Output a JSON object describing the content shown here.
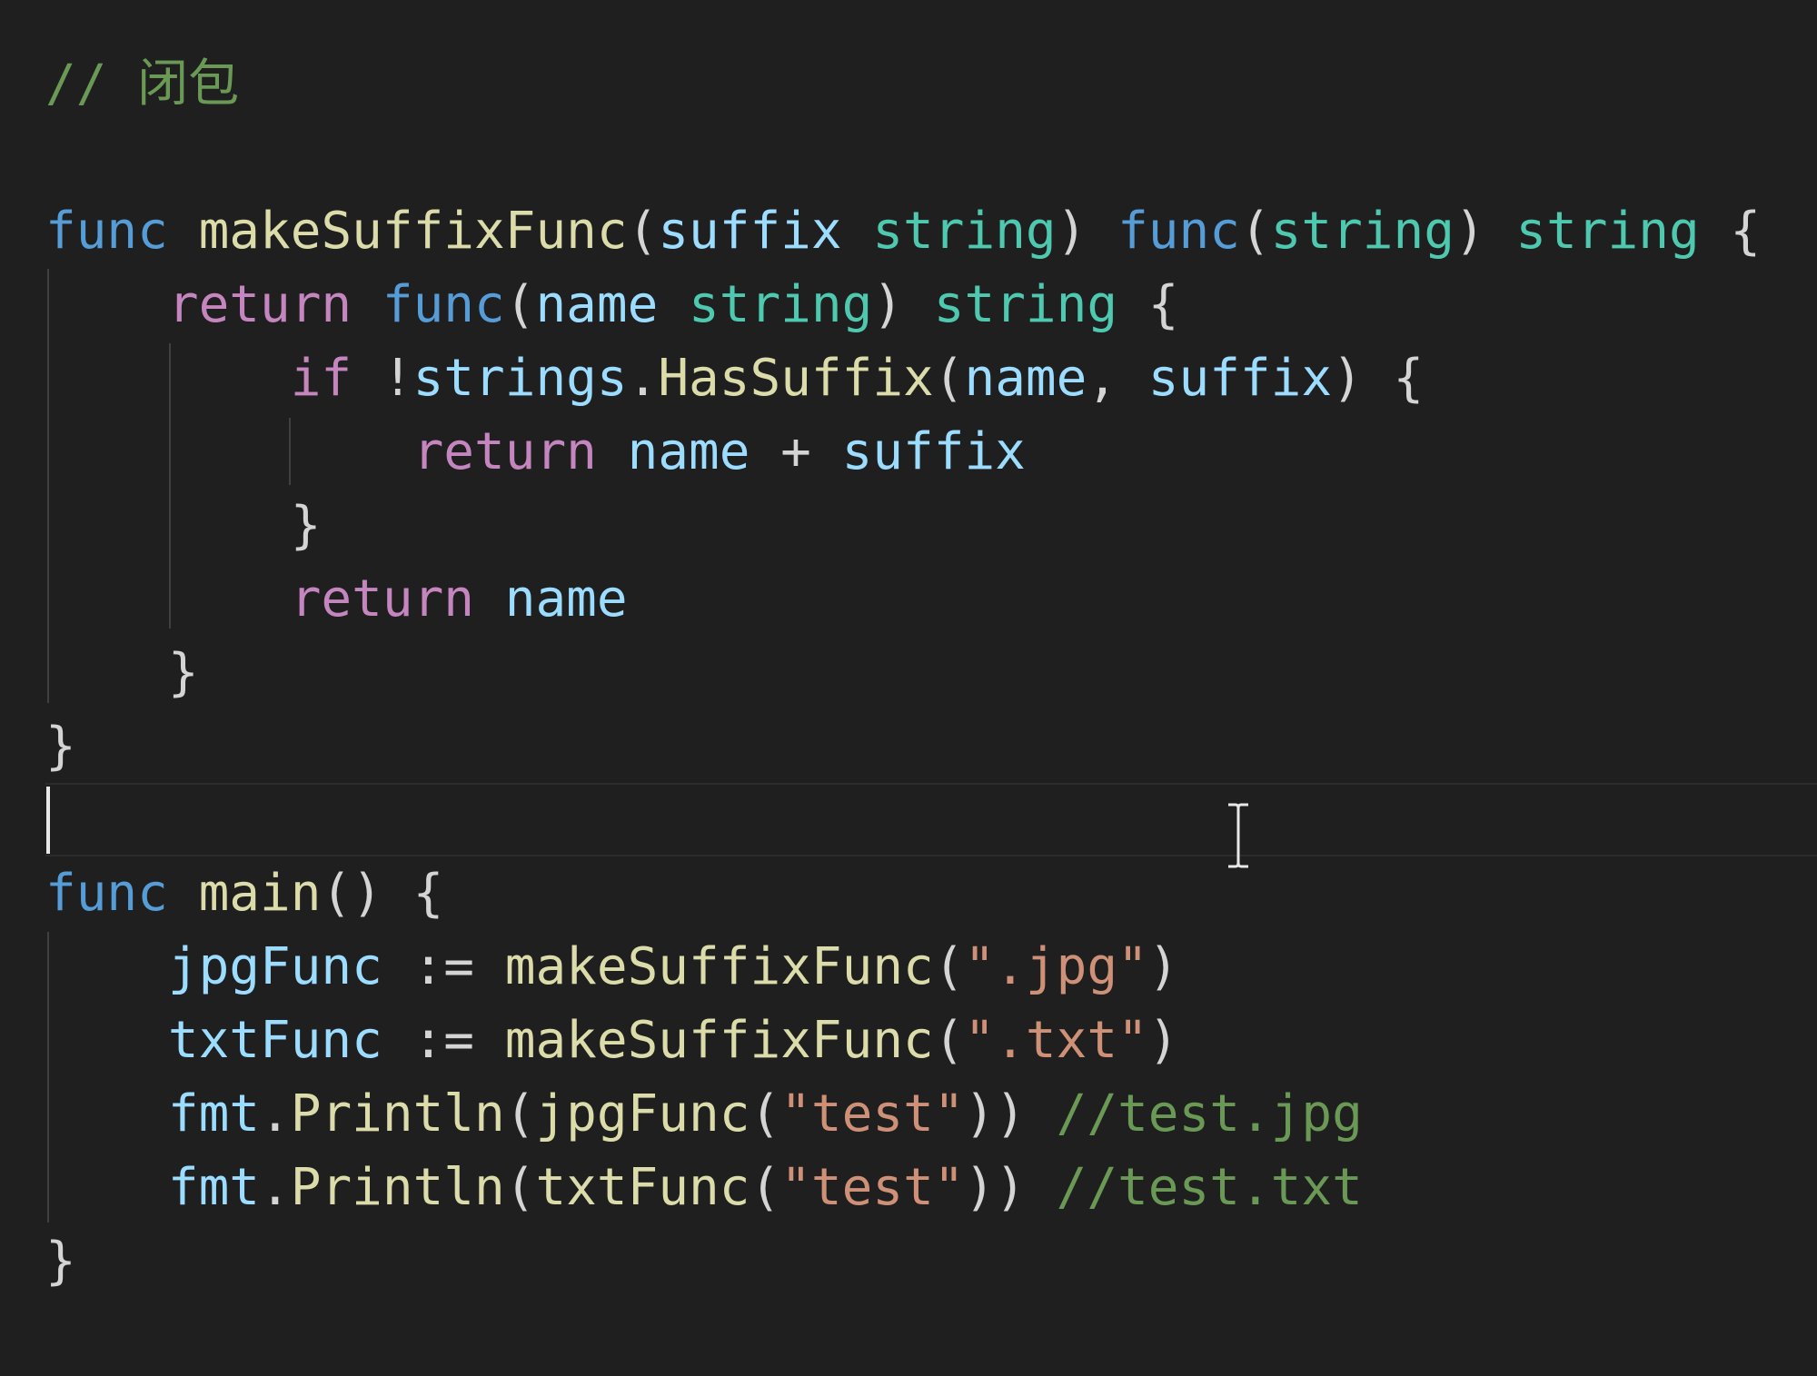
{
  "editor": {
    "lines": [
      [
        {
          "t": "// 闭包",
          "c": "comment"
        }
      ],
      [],
      [
        {
          "t": "func",
          "c": "keyword"
        },
        {
          "t": " ",
          "c": "punct"
        },
        {
          "t": "makeSuffixFunc",
          "c": "func"
        },
        {
          "t": "(",
          "c": "punct"
        },
        {
          "t": "suffix",
          "c": "param"
        },
        {
          "t": " ",
          "c": "punct"
        },
        {
          "t": "string",
          "c": "type"
        },
        {
          "t": ") ",
          "c": "punct"
        },
        {
          "t": "func",
          "c": "keyword"
        },
        {
          "t": "(",
          "c": "punct"
        },
        {
          "t": "string",
          "c": "type"
        },
        {
          "t": ") ",
          "c": "punct"
        },
        {
          "t": "string",
          "c": "type"
        },
        {
          "t": " {",
          "c": "punct"
        }
      ],
      [
        {
          "t": "    ",
          "c": "punct"
        },
        {
          "t": "return",
          "c": "control"
        },
        {
          "t": " ",
          "c": "punct"
        },
        {
          "t": "func",
          "c": "keyword"
        },
        {
          "t": "(",
          "c": "punct"
        },
        {
          "t": "name",
          "c": "param"
        },
        {
          "t": " ",
          "c": "punct"
        },
        {
          "t": "string",
          "c": "type"
        },
        {
          "t": ") ",
          "c": "punct"
        },
        {
          "t": "string",
          "c": "type"
        },
        {
          "t": " {",
          "c": "punct"
        }
      ],
      [
        {
          "t": "        ",
          "c": "punct"
        },
        {
          "t": "if",
          "c": "control"
        },
        {
          "t": " !",
          "c": "op"
        },
        {
          "t": "strings",
          "c": "param"
        },
        {
          "t": ".",
          "c": "punct"
        },
        {
          "t": "HasSuffix",
          "c": "func"
        },
        {
          "t": "(",
          "c": "punct"
        },
        {
          "t": "name",
          "c": "param"
        },
        {
          "t": ", ",
          "c": "punct"
        },
        {
          "t": "suffix",
          "c": "param"
        },
        {
          "t": ") {",
          "c": "punct"
        }
      ],
      [
        {
          "t": "            ",
          "c": "punct"
        },
        {
          "t": "return",
          "c": "control"
        },
        {
          "t": " ",
          "c": "punct"
        },
        {
          "t": "name",
          "c": "param"
        },
        {
          "t": " + ",
          "c": "op"
        },
        {
          "t": "suffix",
          "c": "param"
        }
      ],
      [
        {
          "t": "        }",
          "c": "punct"
        }
      ],
      [
        {
          "t": "        ",
          "c": "punct"
        },
        {
          "t": "return",
          "c": "control"
        },
        {
          "t": " ",
          "c": "punct"
        },
        {
          "t": "name",
          "c": "param"
        }
      ],
      [
        {
          "t": "    }",
          "c": "punct"
        }
      ],
      [
        {
          "t": "}",
          "c": "punct"
        }
      ],
      [],
      [
        {
          "t": "func",
          "c": "keyword"
        },
        {
          "t": " ",
          "c": "punct"
        },
        {
          "t": "main",
          "c": "func"
        },
        {
          "t": "() {",
          "c": "punct"
        }
      ],
      [
        {
          "t": "    ",
          "c": "punct"
        },
        {
          "t": "jpgFunc",
          "c": "param"
        },
        {
          "t": " := ",
          "c": "op"
        },
        {
          "t": "makeSuffixFunc",
          "c": "func"
        },
        {
          "t": "(",
          "c": "punct"
        },
        {
          "t": "\".jpg\"",
          "c": "string"
        },
        {
          "t": ")",
          "c": "punct"
        }
      ],
      [
        {
          "t": "    ",
          "c": "punct"
        },
        {
          "t": "txtFunc",
          "c": "param"
        },
        {
          "t": " := ",
          "c": "op"
        },
        {
          "t": "makeSuffixFunc",
          "c": "func"
        },
        {
          "t": "(",
          "c": "punct"
        },
        {
          "t": "\".txt\"",
          "c": "string"
        },
        {
          "t": ")",
          "c": "punct"
        }
      ],
      [
        {
          "t": "    ",
          "c": "punct"
        },
        {
          "t": "fmt",
          "c": "param"
        },
        {
          "t": ".",
          "c": "punct"
        },
        {
          "t": "Println",
          "c": "func"
        },
        {
          "t": "(",
          "c": "punct"
        },
        {
          "t": "jpgFunc",
          "c": "func"
        },
        {
          "t": "(",
          "c": "punct"
        },
        {
          "t": "\"test\"",
          "c": "string"
        },
        {
          "t": ")) ",
          "c": "punct"
        },
        {
          "t": "//test.jpg",
          "c": "comment"
        }
      ],
      [
        {
          "t": "    ",
          "c": "punct"
        },
        {
          "t": "fmt",
          "c": "param"
        },
        {
          "t": ".",
          "c": "punct"
        },
        {
          "t": "Println",
          "c": "func"
        },
        {
          "t": "(",
          "c": "punct"
        },
        {
          "t": "txtFunc",
          "c": "func"
        },
        {
          "t": "(",
          "c": "punct"
        },
        {
          "t": "\"test\"",
          "c": "string"
        },
        {
          "t": ")) ",
          "c": "punct"
        },
        {
          "t": "//test.txt",
          "c": "comment"
        }
      ],
      [
        {
          "t": "}",
          "c": "punct"
        }
      ]
    ],
    "cursor_line": 11
  }
}
